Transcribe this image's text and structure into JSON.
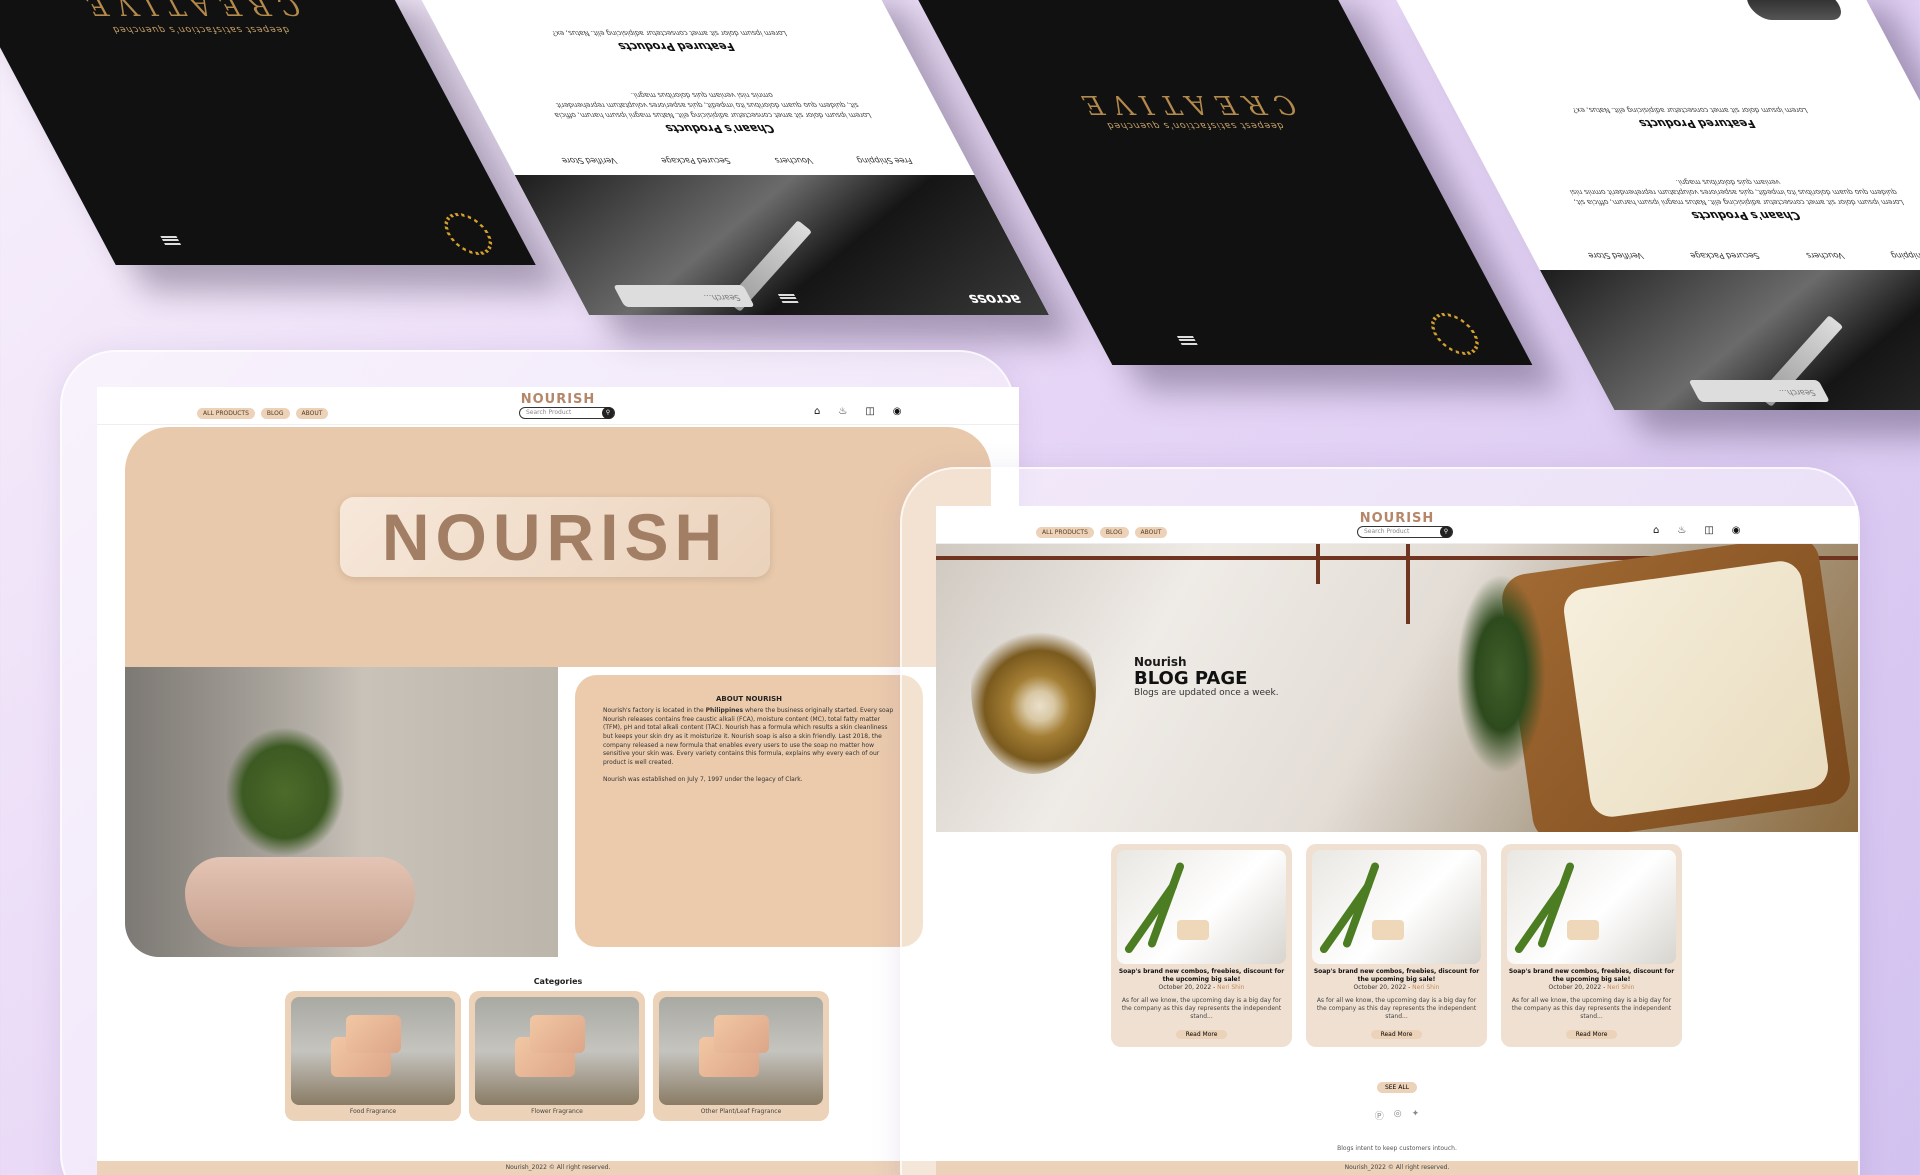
{
  "mockups": {
    "creative_word": "CREATIVE",
    "creative_sub": "deepest satisfaction's quenched",
    "featured_title": "Featured Products",
    "featured_text": "Lorem ipsum dolor sit amet consectetur adipisicing elit. Natus, ex?",
    "chaan_title": "Chaan's Products",
    "chaan_text": "Lorem ipsum dolor sit amet consectetur adipisicing elit. Natus magni ipsum harum, officia sit, quidem quo quam doloribus ito impedit, quis asperiores voluptatum reprehenderit omnis nisi veniam quis doloribus magni.",
    "services": [
      "Free Shipping",
      "Vouchers",
      "Secured Package",
      "Verified Store"
    ],
    "search_placeholder": "Search...",
    "across": "across"
  },
  "nourish_home": {
    "nav": {
      "links": [
        "ALL PRODUCTS",
        "BLOG",
        "ABOUT"
      ],
      "brand": "NOURISH",
      "search_placeholder": "Search Product",
      "icons": [
        "home-icon",
        "bell-icon",
        "cart-icon",
        "user-icon"
      ]
    },
    "hero_logo": "NOURISH",
    "about": {
      "title": "ABOUT NOURISH",
      "p1_prefix": "Nourish's factory is located in the ",
      "p1_bold": "Philippines",
      "p1_rest": " where the business originally started. Every soap Nourish releases contains free caustic alkali (FCA), moisture content (MC), total fatty matter (TFM), pH and total alkali content (TAC). Nourish has a formula which results a skin cleanliness but keeps your skin dry as it moisturize it. Nourish soap is also a skin friendly. Last 2018, the company released a new formula that enables every users to use the soap no matter how sensitive your skin was. Every variety contains this formula, explains why every each of our product is well created.",
      "p2": "Nourish was established on July 7, 1997 under the legacy of Clark."
    },
    "categories": {
      "title": "Categories",
      "items": [
        "Food Fragrance",
        "Flower Fragrance",
        "Other Plant/Leaf Fragrance"
      ]
    },
    "footer": "Nourish_2022 © All right reserved."
  },
  "nourish_blog": {
    "nav": {
      "links": [
        "ALL PRODUCTS",
        "BLOG",
        "ABOUT"
      ],
      "brand": "NOURISH",
      "search_placeholder": "Search Product"
    },
    "hero": {
      "kicker": "Nourish",
      "title": "BLOG PAGE",
      "subtitle": "Blogs are updated once a week."
    },
    "posts": [
      {
        "title": "Soap's brand new combos, freebies, discount for the upcoming big sale!",
        "date": "October 20, 2022 - ",
        "author": "Neri Shin",
        "body": "As for all we know, the upcoming day is a big day for the company as this day represents the independent stand...",
        "cta": "Read More"
      },
      {
        "title": "Soap's brand new combos, freebies, discount for the upcoming big sale!",
        "date": "October 20, 2022 - ",
        "author": "Neri Shin",
        "body": "As for all we know, the upcoming day is a big day for the company as this day represents the independent stand...",
        "cta": "Read More"
      },
      {
        "title": "Soap's brand new combos, freebies, discount for the upcoming big sale!",
        "date": "October 20, 2022 - ",
        "author": "Neri Shin",
        "body": "As for all we know, the upcoming day is a big day for the company as this day represents the independent stand...",
        "cta": "Read More"
      }
    ],
    "see_all": "SEE ALL",
    "social": [
      "facebook-icon",
      "instagram-icon",
      "twitter-icon"
    ],
    "tagline": "Blogs intent to keep customers intouch.",
    "footer": "Nourish_2022 © All right reserved."
  },
  "colors": {
    "accent_beige": "#ebd2b8",
    "hero_beige": "#e9c9ab",
    "brand_text": "#b58768",
    "gold": "#b38a4c"
  }
}
